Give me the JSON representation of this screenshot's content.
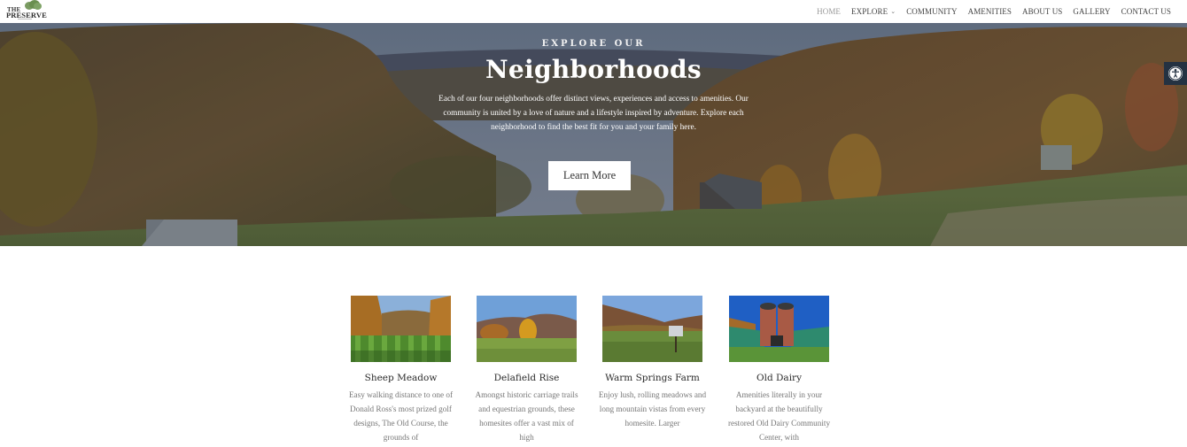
{
  "header": {
    "logo": {
      "top_text": "THE",
      "name": "PRESERVE"
    },
    "nav": [
      {
        "label": "HOME",
        "active": true,
        "dropdown": false
      },
      {
        "label": "EXPLORE",
        "active": false,
        "dropdown": true
      },
      {
        "label": "COMMUNITY",
        "active": false,
        "dropdown": false
      },
      {
        "label": "AMENITIES",
        "active": false,
        "dropdown": false
      },
      {
        "label": "ABOUT US",
        "active": false,
        "dropdown": false
      },
      {
        "label": "GALLERY",
        "active": false,
        "dropdown": false
      },
      {
        "label": "CONTACT US",
        "active": false,
        "dropdown": false
      }
    ],
    "dropdown_icon": "chevron-down-icon"
  },
  "hero": {
    "eyebrow": "EXPLORE OUR",
    "title": "Neighborhoods",
    "description": "Each of our four neighborhoods offer distinct views, experiences and access to amenities. Our community is united by a love of nature and a lifestyle inspired by adventure. Explore each neighborhood to find the best fit for you and your family here.",
    "cta_label": "Learn More",
    "accessibility_icon": "accessibility-icon"
  },
  "neighborhoods": [
    {
      "title": "Sheep Meadow",
      "description": "Easy walking distance to one of Donald Ross's most prized golf designs, The Old Course, the grounds of"
    },
    {
      "title": "Delafield Rise",
      "description": "Amongst historic carriage trails and equestrian grounds, these homesites offer a vast mix of high"
    },
    {
      "title": "Warm Springs Farm",
      "description": "Enjoy lush, rolling meadows and long mountain vistas from every homesite. Larger"
    },
    {
      "title": "Old Dairy",
      "description": "Amenities literally in your backyard at the beautifully restored Old Dairy Community Center, with"
    }
  ],
  "colors": {
    "nav_text": "#444444",
    "nav_active": "#999999",
    "accessibility_bg": "#243242",
    "card_title": "#2b2b2b",
    "card_text": "#777777"
  }
}
